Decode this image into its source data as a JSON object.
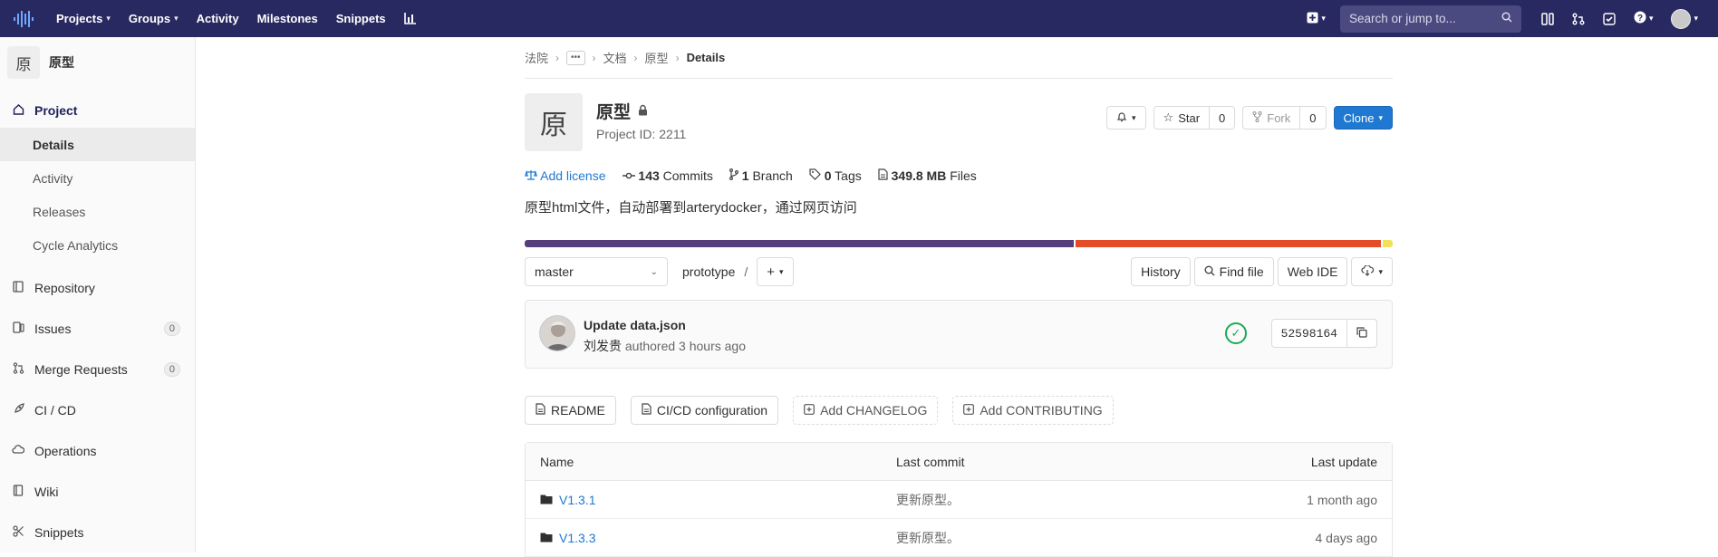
{
  "topbar": {
    "nav": [
      {
        "label": "Projects",
        "dropdown": true
      },
      {
        "label": "Groups",
        "dropdown": true
      },
      {
        "label": "Activity",
        "dropdown": false
      },
      {
        "label": "Milestones",
        "dropdown": false
      },
      {
        "label": "Snippets",
        "dropdown": false
      }
    ],
    "search_placeholder": "Search or jump to..."
  },
  "sidebar": {
    "project_avatar": "原",
    "project_name": "原型",
    "section": "Project",
    "subitems": [
      "Details",
      "Activity",
      "Releases",
      "Cycle Analytics"
    ],
    "items": [
      {
        "label": "Repository",
        "icon": "repository-icon"
      },
      {
        "label": "Issues",
        "icon": "issues-icon",
        "count": "0"
      },
      {
        "label": "Merge Requests",
        "icon": "merge-request-icon",
        "count": "0"
      },
      {
        "label": "CI / CD",
        "icon": "rocket-icon"
      },
      {
        "label": "Operations",
        "icon": "cloud-gear-icon"
      },
      {
        "label": "Wiki",
        "icon": "book-icon"
      },
      {
        "label": "Snippets",
        "icon": "scissors-icon"
      }
    ]
  },
  "breadcrumb": {
    "items": [
      "法院",
      "文档",
      "原型"
    ],
    "current": "Details"
  },
  "project": {
    "avatar": "原",
    "title": "原型",
    "id_text": "Project ID: 2211",
    "star_label": "Star",
    "star_count": "0",
    "fork_label": "Fork",
    "fork_count": "0",
    "clone_label": "Clone",
    "license_label": "Add license",
    "commits_count": "143",
    "commits_label": "Commits",
    "branch_count": "1",
    "branch_label": "Branch",
    "tags_count": "0",
    "tags_label": "Tags",
    "files_size": "349.8 MB",
    "files_label": "Files",
    "description": "原型html文件，自动部署到arterydocker，通过网页访问"
  },
  "languages": [
    {
      "fraction": 0.633,
      "color": "#563d7c"
    },
    {
      "fraction": 0.353,
      "color": "#e34c26"
    },
    {
      "fraction": 0.014,
      "color": "#f1e05a"
    }
  ],
  "toolbar": {
    "branch": "master",
    "path": "prototype",
    "path_sep": "/",
    "history": "History",
    "find_file": "Find file",
    "web_ide": "Web IDE"
  },
  "commit": {
    "title": "Update data.json",
    "author": "刘发贵",
    "meta": "authored 3 hours ago",
    "sha": "52598164"
  },
  "shortcuts": {
    "readme": "README",
    "cicd": "CI/CD configuration",
    "changelog": "Add CHANGELOG",
    "contributing": "Add CONTRIBUTING"
  },
  "tree": {
    "headers": {
      "name": "Name",
      "last_commit": "Last commit",
      "last_update": "Last update"
    },
    "rows": [
      {
        "name": "V1.3.1",
        "commit": "更新原型。",
        "updated": "1 month ago"
      },
      {
        "name": "V1.3.3",
        "commit": "更新原型。",
        "updated": "4 days ago"
      }
    ]
  }
}
